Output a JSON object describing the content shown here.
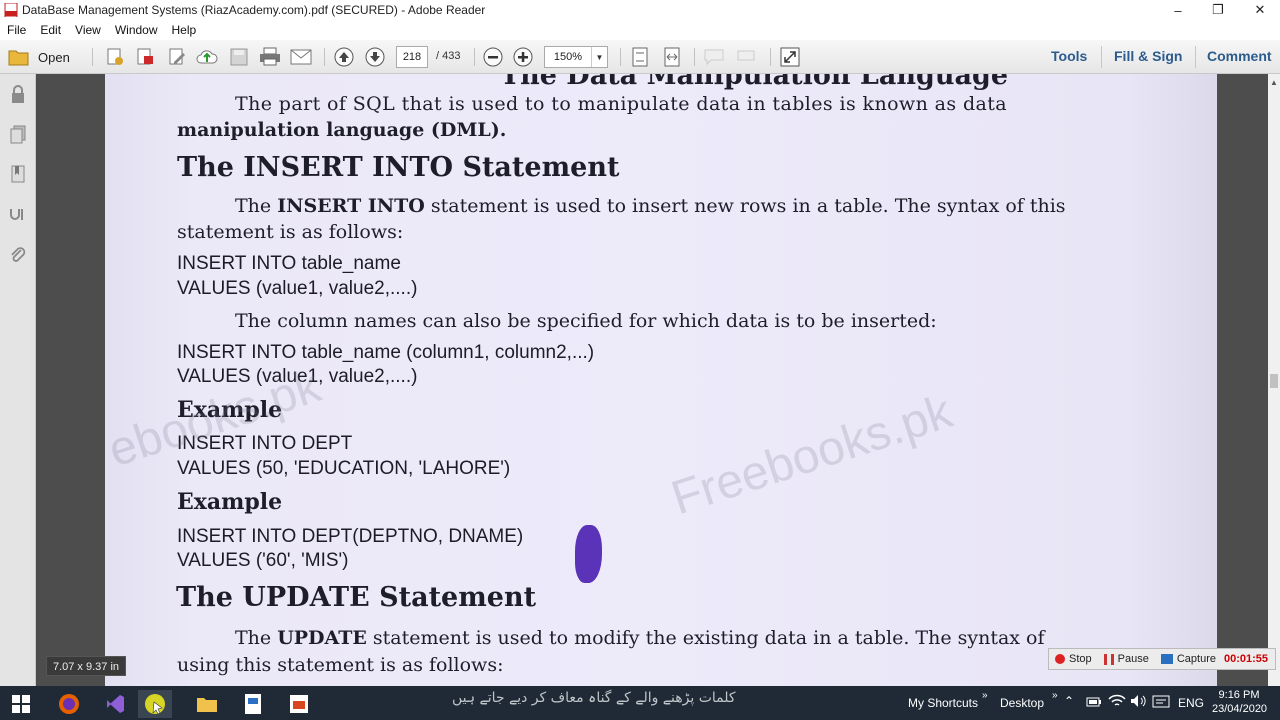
{
  "window": {
    "title": "DataBase Management Systems (RiazAcademy.com).pdf (SECURED) - Adobe Reader",
    "minimize_label": "–",
    "maximize_label": "❐",
    "close_label": "✕"
  },
  "menu": {
    "items": [
      "File",
      "Edit",
      "View",
      "Window",
      "Help"
    ]
  },
  "toolbar": {
    "open_label": "Open",
    "page_current": "218",
    "page_total": "/ 433",
    "zoom_value": "150%",
    "tools_label": "Tools",
    "fill_sign_label": "Fill & Sign",
    "comment_label": "Comment"
  },
  "document": {
    "cut_heading": "The Data Manipulation Language",
    "intro_line1": "The part of SQL that is used to to manipulate data in tables is known as data",
    "intro_line2_bold": "manipulation language (DML).",
    "heading_insert": "The INSERT INTO Statement",
    "insert_p1_pre": "The ",
    "insert_p1_bold": "INSERT INTO",
    "insert_p1_post": " statement is used to insert new rows in a table. The syntax of this",
    "insert_p1_line2": "statement is as follows:",
    "code1_line1": "INSERT INTO table_name",
    "code1_line2": "VALUES (value1, value2,....)",
    "insert_p2": "The column names can also be specified for which data is to be inserted:",
    "code2_line1": "INSERT INTO table_name (column1, column2,...)",
    "code2_line2": "VALUES (value1, value2,....)",
    "example1_label": "Example",
    "code3_line1": "INSERT INTO DEPT",
    "code3_line2": "VALUES (50, 'EDUCATION, 'LAHORE')",
    "example2_label": "Example",
    "code4_line1": "INSERT INTO DEPT(DEPTNO, DNAME)",
    "code4_line2": "VALUES ('60', 'MIS')",
    "heading_update": "The UPDATE Statement",
    "update_p1_pre": "The ",
    "update_p1_bold": "UPDATE",
    "update_p1_post": " statement is used to modify the existing data in a table. The syntax of",
    "update_p1_line2": "using this statement is as follows:",
    "watermark_left": "ebooks.pk",
    "watermark_center": "Freebooks.pk",
    "page_size_tip": "7.07 x 9.37 in"
  },
  "capture": {
    "stop_label": "Stop",
    "pause_label": "Pause",
    "capture_label": "Capture",
    "elapsed": "00:01:55"
  },
  "taskbar": {
    "urdu_text": "کلمات پڑھنے والے کے گناہ معاف کر دیے جاتے ہیں",
    "my_shortcuts": "My Shortcuts",
    "desktop": "Desktop",
    "language": "ENG",
    "time": "9:16 PM",
    "date": "23/04/2020"
  },
  "colors": {
    "accent_link": "#2c5b8d",
    "taskbar": "#1f2a36",
    "stamp": "#4a1fb0"
  }
}
